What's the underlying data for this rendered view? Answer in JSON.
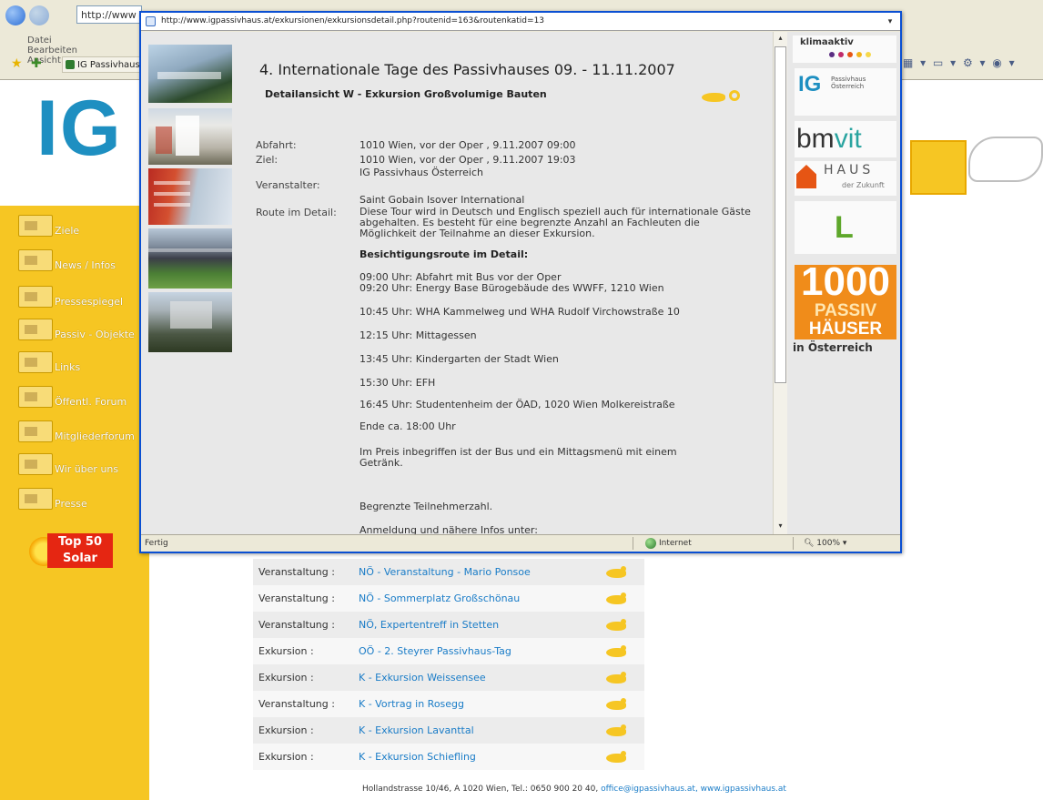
{
  "bg_browser": {
    "address": "http://www",
    "menu": [
      "Datei",
      "Bearbeiten",
      "Ansicht"
    ],
    "tab_label": "IG Passivhaus Ö"
  },
  "bg_page": {
    "logo": "IG",
    "sidebar_items": [
      "Ziele",
      "News / Infos",
      "Pressespiegel",
      "Passiv - Objekte",
      "Links",
      "Öffentl. Forum",
      "Mitgliederforum",
      "Wir über uns",
      "Presse"
    ],
    "top50": {
      "line1": "Top 50",
      "line2": "Solar"
    },
    "events": [
      {
        "type": "Veranstaltung :",
        "title": "NÖ - Veranstaltung - Mario Ponsoe"
      },
      {
        "type": "Veranstaltung :",
        "title": "NÖ - Sommerplatz Großschönau"
      },
      {
        "type": "Veranstaltung :",
        "title": "NÖ, Expertentreff in Stetten"
      },
      {
        "type": "Exkursion :",
        "title": "OÖ - 2. Steyrer Passivhaus-Tag"
      },
      {
        "type": "Exkursion :",
        "title": "K - Exkursion Weissensee"
      },
      {
        "type": "Veranstaltung :",
        "title": "K - Vortrag in Rosegg"
      },
      {
        "type": "Exkursion :",
        "title": "K - Exkursion Lavanttal"
      },
      {
        "type": "Exkursion :",
        "title": "K - Exkursion Schiefling"
      }
    ],
    "footer_text": "Hollandstrasse 10/46, A 1020 Wien, Tel.: 0650 900 20 40,",
    "footer_links": "office@igpassivhaus.at, www.igpassivhaus.at"
  },
  "popup": {
    "address": "http://www.igpassivhaus.at/exkursionen/exkursionsdetail.php?routenid=163&routenkatid=13",
    "status_text": "Fertig",
    "status_zone": "Internet",
    "status_zoom": "100%",
    "page_title": "4. Internationale Tage des Passivhauses 09. - 11.11.2007",
    "detail_title": "Detailansicht W - Exkursion Großvolumige Bauten",
    "fields": {
      "abfahrt_label": "Abfahrt:",
      "abfahrt_value": "1010 Wien, vor der Oper , 9.11.2007 09:00",
      "ziel_label": "Ziel:",
      "ziel_value": "1010 Wien, vor der Oper , 9.11.2007 19:03",
      "veranstalter_label": "Veranstalter:",
      "veranstalter_value1": "IG Passivhaus Österreich",
      "veranstalter_value2": "Saint Gobain Isover International",
      "route_label": "Route im Detail:",
      "route_intro": "Diese Tour wird in Deutsch und Englisch speziell auch für internationale Gäste abgehalten. Es besteht für eine begrenzte Anzahl an Fachleuten die Möglichkeit der Teilnahme an dieser Exkursion."
    },
    "route_heading": "Besichtigungsroute im Detail:",
    "route_stops": [
      {
        "line1": "09:00 Uhr: Abfahrt mit Bus vor der Oper",
        "line2": "09:20 Uhr: Energy Base Bürogebäude des WWFF, 1210 Wien"
      },
      {
        "line1": "10:45 Uhr: WHA Kammelweg und WHA Rudolf Virchowstraße 10",
        "line2": ""
      },
      {
        "line1": "12:15 Uhr: Mittagessen",
        "line2": ""
      },
      {
        "line1": "13:45 Uhr: Kindergarten der Stadt Wien",
        "line2": ""
      },
      {
        "line1": "15:30 Uhr: EFH",
        "line2": ""
      },
      {
        "line1": "16:45 Uhr: Studentenheim der ÖAD, 1020 Wien Molkereistraße",
        "line2": ""
      }
    ],
    "ende": "Ende ca. 18:00 Uhr",
    "preis": "Im Preis inbegriffen ist der Bus und ein Mittagsmenü mit einem Getränk.",
    "begrenzt": "Begrenzte Teilnehmerzahl.",
    "anmeldung": "Anmeldung und nähere Infos unter:",
    "logos": {
      "klima": "klimaaktiv",
      "ig": "IG",
      "ig_sub": "Passivhaus Österreich",
      "bmvit_a": "bm",
      "bmvit_b": "vit",
      "haus": "HAUS",
      "haus_sub": "der Zukunft",
      "l": "L",
      "k1000": "1000",
      "k1000_b": "PASSIV",
      "k1000_c": "HÄUSER",
      "in_oe": "in Österreich"
    },
    "colors": {
      "accent_yellow": "#f6c623",
      "ig_blue": "#1e8fc1",
      "window_blue": "#0a4fd2"
    }
  }
}
